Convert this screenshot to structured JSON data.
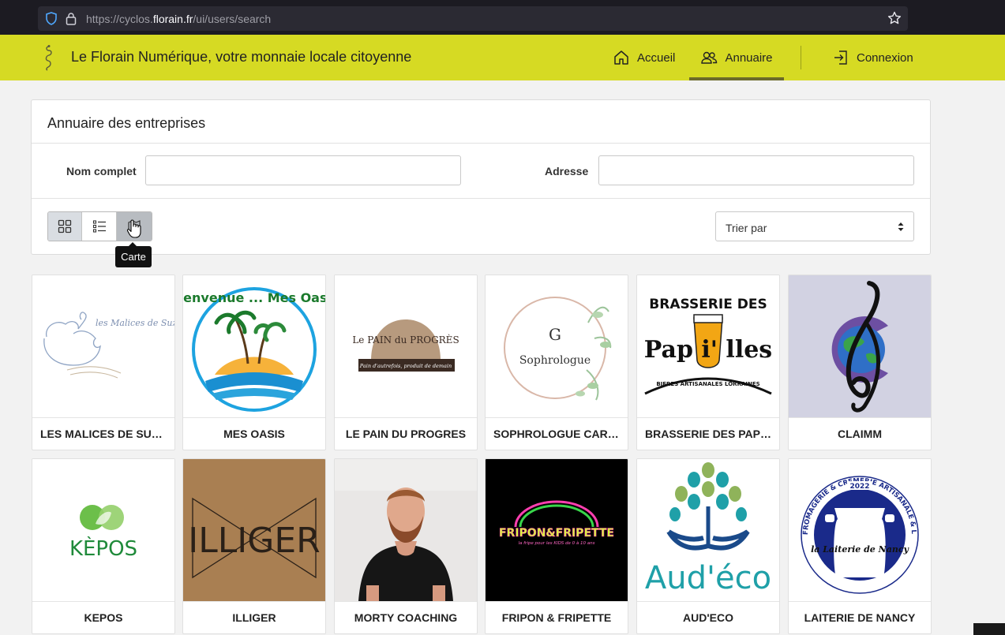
{
  "browser": {
    "url_prefix": "https://cyclos.",
    "url_domain": "florain.fr",
    "url_path": "/ui/users/search"
  },
  "header": {
    "title": "Le Florain Numérique, votre monnaie locale citoyenne",
    "nav": {
      "home": "Accueil",
      "directory": "Annuaire",
      "login": "Connexion"
    },
    "accent_color": "#d6da23"
  },
  "search": {
    "title": "Annuaire des entreprises",
    "name_label": "Nom complet",
    "name_value": "",
    "address_label": "Adresse",
    "address_value": "",
    "sort_label": "Trier par",
    "views": [
      "grid-icon",
      "list-icon",
      "map-icon"
    ],
    "tooltip": "Carte"
  },
  "tiles": [
    {
      "name": "LES MALICES DE SUZE…",
      "logo_text": "les Malices de Suzette"
    },
    {
      "name": "MES OASIS",
      "logo_text": "Bienvenue ... Mes Oasis"
    },
    {
      "name": "LE PAIN DU PROGRES",
      "logo_text": "Le PAIN du PROGRÈS",
      "logo_sub": "Pain d'autrefois, produit de demain"
    },
    {
      "name": "SOPHROLOGUE CARO…",
      "logo_text": "Sophrologue"
    },
    {
      "name": "BRASSERIE DES PAPIL…",
      "logo_text": "BRASSERIE DES",
      "logo_main": "Pap i' lles",
      "logo_sub": "BIERES ARTISANALES LORRAINES"
    },
    {
      "name": "CLAIMM"
    },
    {
      "name": "KEPOS",
      "logo_text": "KÈPOS"
    },
    {
      "name": "ILLIGER",
      "logo_text": "ILLIGER"
    },
    {
      "name": "MORTY COACHING"
    },
    {
      "name": "FRIPON & FRIPETTE",
      "logo_text": "FRIPON&FRIPETTE",
      "logo_sub": "la fripe pour les KIDS de 0 à 10 ans"
    },
    {
      "name": "AUD'ECO",
      "logo_text": "Aud'éco"
    },
    {
      "name": "LAITERIE DE NANCY",
      "logo_text": "la Laiterie de Nancy",
      "logo_ring": "FROMAGERIE & CRÉMERIE ARTISANALE & LOCALE",
      "logo_year": "2022"
    }
  ]
}
